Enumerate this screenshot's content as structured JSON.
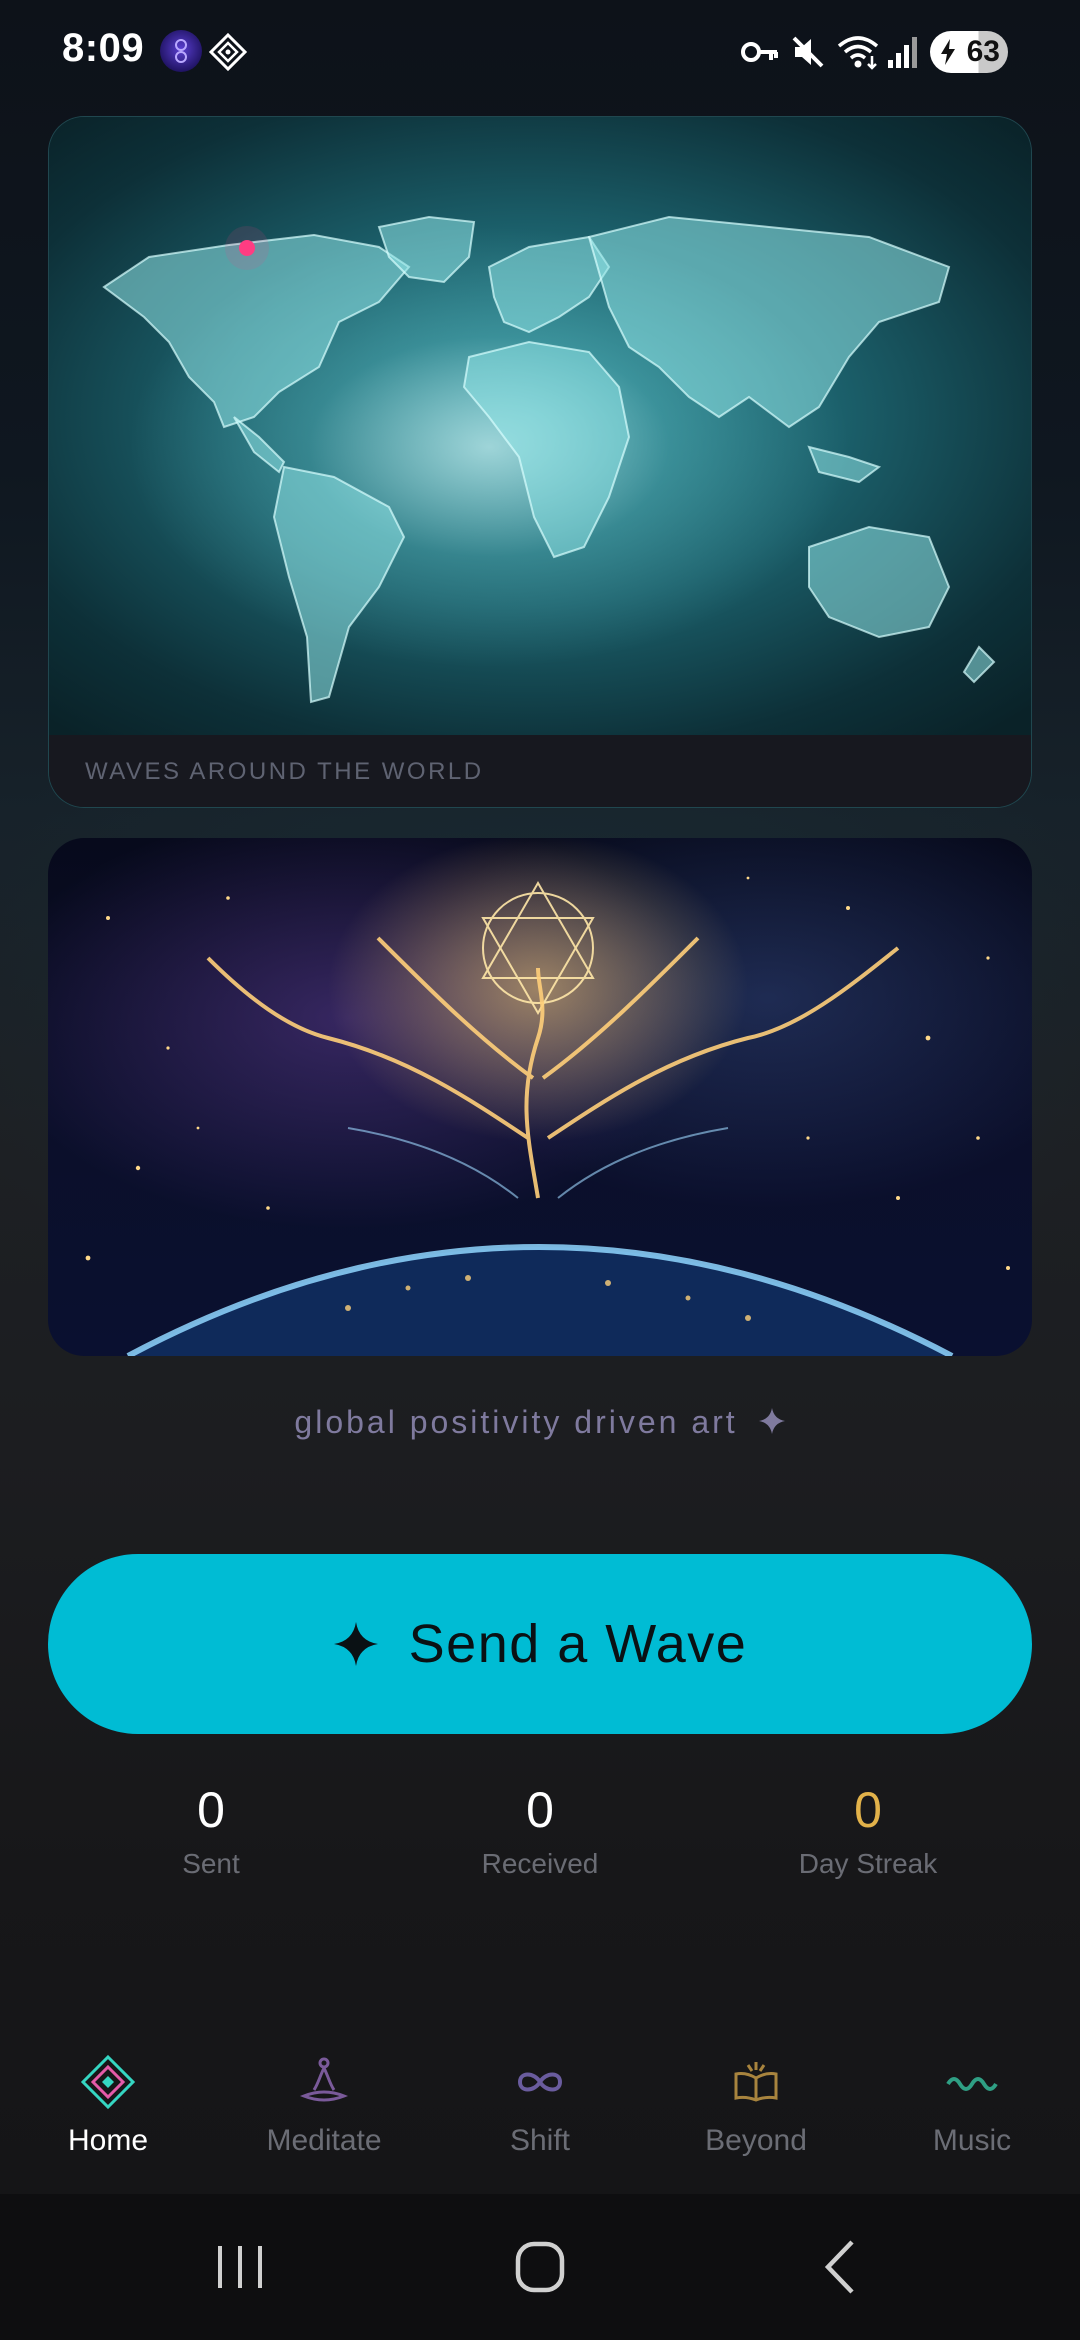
{
  "status_bar": {
    "time": "8:09",
    "battery_level": "63",
    "icons": [
      "app-orb-icon",
      "app-diamond-icon",
      "vpn-key-icon",
      "mute-icon",
      "wifi-icon",
      "signal-icon",
      "battery-charging-icon"
    ]
  },
  "map_card": {
    "caption": "WAVES AROUND THE WORLD"
  },
  "art_card": {
    "image": "tree-of-life-over-earth-artwork"
  },
  "tagline": "global positivity driven art",
  "send_button": {
    "label": "Send a Wave",
    "icon": "sparkle-icon",
    "color": "#00bcd4"
  },
  "stats": [
    {
      "value": "0",
      "label": "Sent",
      "color": "#ffffff"
    },
    {
      "value": "0",
      "label": "Received",
      "color": "#ffffff"
    },
    {
      "value": "0",
      "label": "Day Streak",
      "color": "#e2b24a"
    }
  ],
  "bottom_nav": {
    "active": "Home",
    "items": [
      {
        "label": "Home",
        "icon": "diamond-icon",
        "color": "#35d6c2"
      },
      {
        "label": "Meditate",
        "icon": "meditation-icon",
        "color": "#7a5a9a"
      },
      {
        "label": "Shift",
        "icon": "infinity-icon",
        "color": "#6a5c9e"
      },
      {
        "label": "Beyond",
        "icon": "open-book-icon",
        "color": "#a8843e"
      },
      {
        "label": "Music",
        "icon": "wave-icon",
        "color": "#2f9f84"
      }
    ]
  },
  "system_nav": [
    "recent-apps-icon",
    "home-icon",
    "back-icon"
  ]
}
